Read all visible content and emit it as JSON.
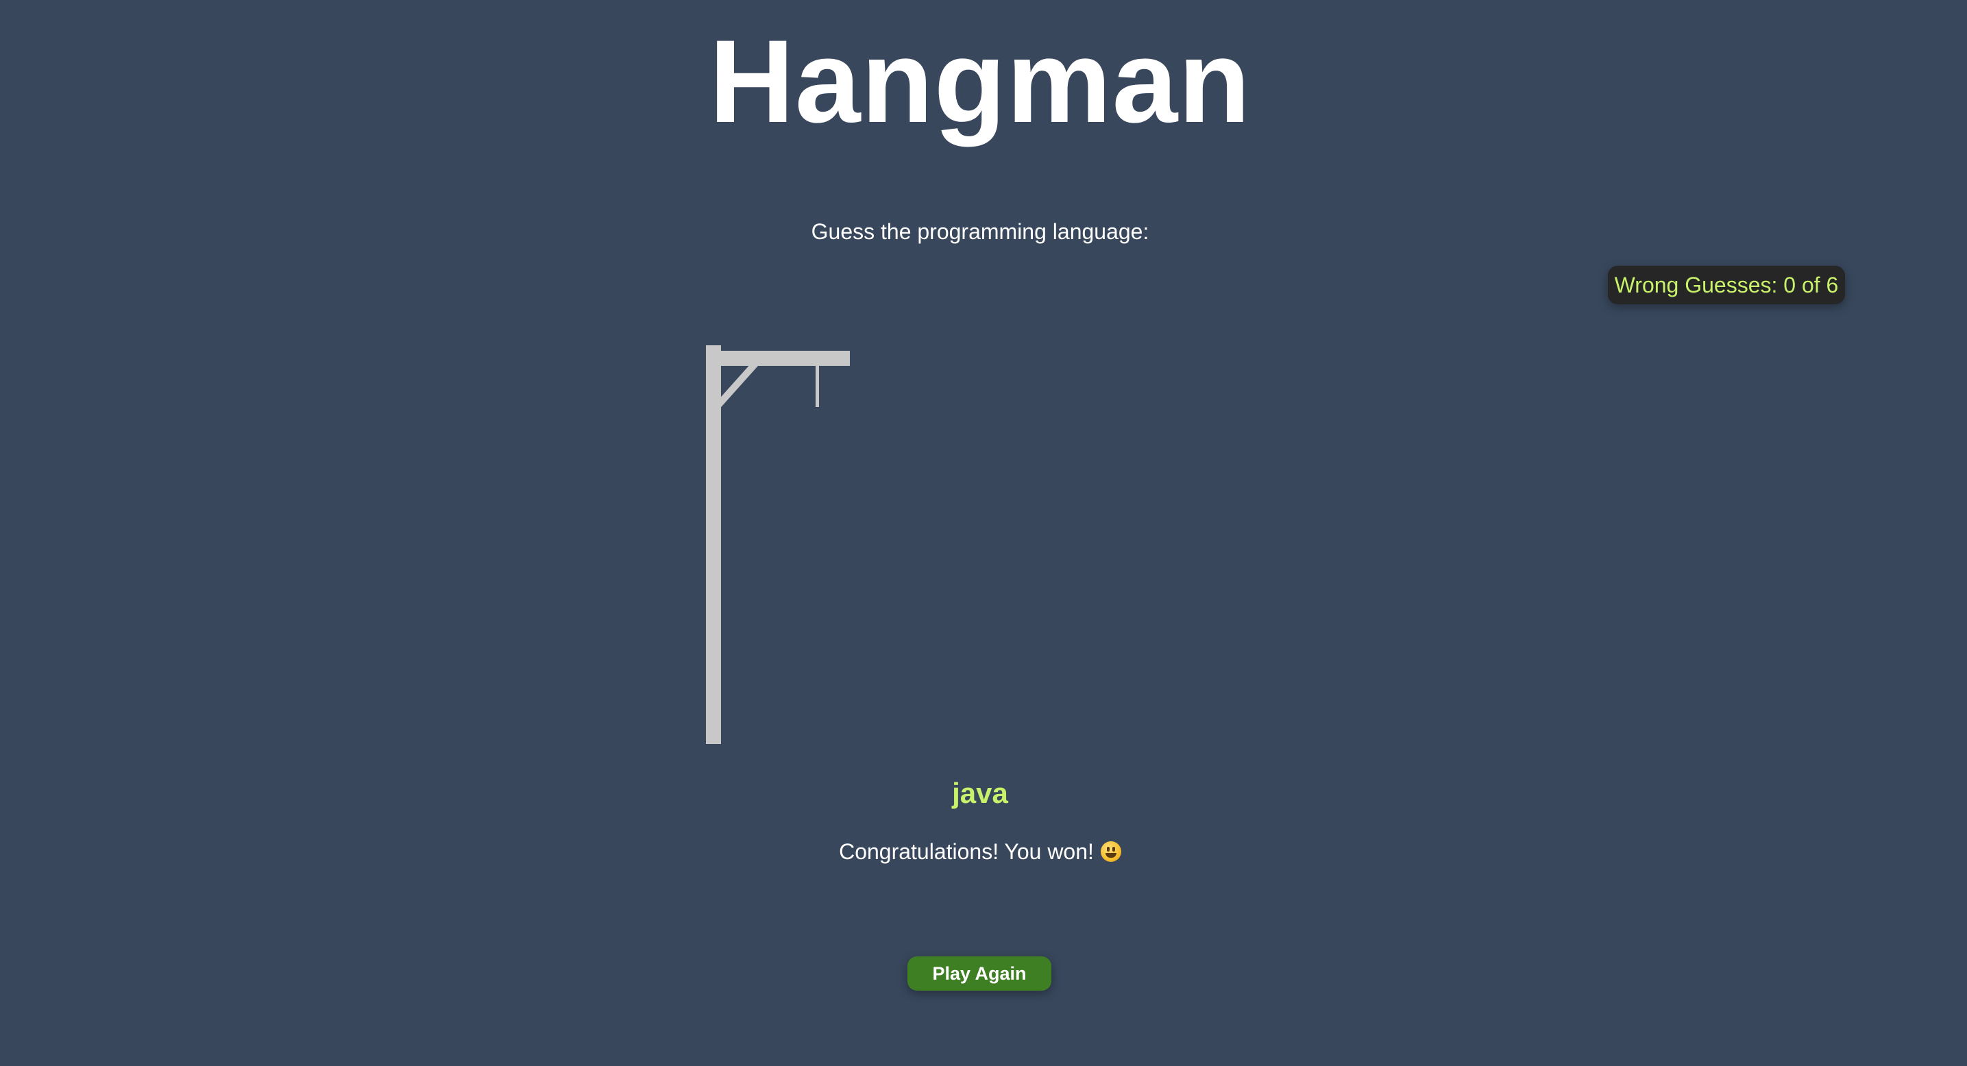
{
  "title": "Hangman",
  "prompt": "Guess the programming language:",
  "wrong_guesses": {
    "label": "Wrong Guesses: 0 of 6",
    "count": 0,
    "max": 6
  },
  "word": "java",
  "result_message": "Congratulations! You won!",
  "result_emoji": "grinning-face-icon",
  "play_again_label": "Play Again",
  "colors": {
    "background": "#38475c",
    "accent": "#c8f26a",
    "gallows": "#c8c8c8",
    "badge_background": "#262626",
    "button": "#3f7f23"
  }
}
